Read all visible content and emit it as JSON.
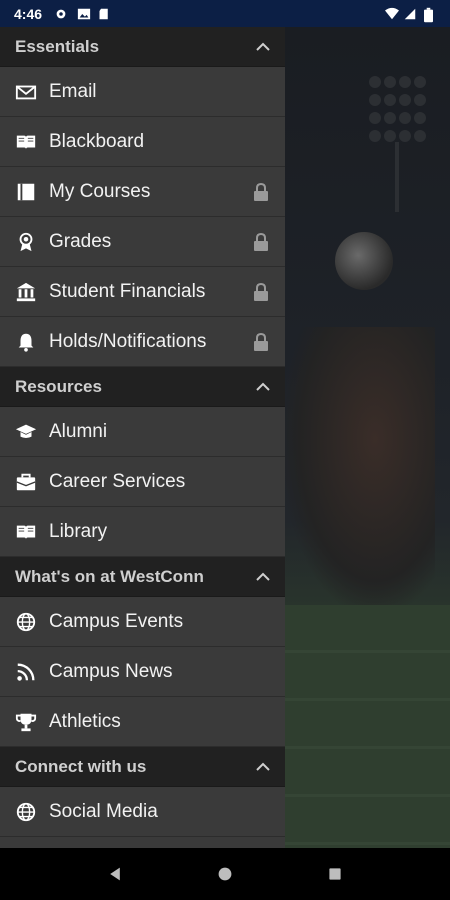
{
  "status_bar": {
    "time": "4:46",
    "icons": [
      "settings-icon",
      "image-icon",
      "sd-card-icon",
      "wifi-icon",
      "signal-icon",
      "battery-icon"
    ]
  },
  "drawer": {
    "sections": [
      {
        "title": "Essentials",
        "items": [
          {
            "label": "Email",
            "icon": "envelope-icon",
            "locked": false
          },
          {
            "label": "Blackboard",
            "icon": "book-open-icon",
            "locked": false
          },
          {
            "label": "My Courses",
            "icon": "book-icon",
            "locked": true
          },
          {
            "label": "Grades",
            "icon": "award-icon",
            "locked": true
          },
          {
            "label": "Student Financials",
            "icon": "bank-icon",
            "locked": true
          },
          {
            "label": "Holds/Notifications",
            "icon": "bell-icon",
            "locked": true
          }
        ]
      },
      {
        "title": "Resources",
        "items": [
          {
            "label": "Alumni",
            "icon": "graduation-cap-icon",
            "locked": false
          },
          {
            "label": "Career Services",
            "icon": "briefcase-icon",
            "locked": false
          },
          {
            "label": "Library",
            "icon": "book-open-icon",
            "locked": false
          }
        ]
      },
      {
        "title": "What's on at WestConn",
        "items": [
          {
            "label": "Campus Events",
            "icon": "globe-icon",
            "locked": false
          },
          {
            "label": "Campus News",
            "icon": "rss-icon",
            "locked": false
          },
          {
            "label": "Athletics",
            "icon": "trophy-icon",
            "locked": false
          }
        ]
      },
      {
        "title": "Connect with us",
        "items": [
          {
            "label": "Social Media",
            "icon": "globe-icon",
            "locked": false
          }
        ]
      }
    ]
  },
  "colors": {
    "status_bar": "#0c1f45",
    "drawer_bg": "#3a3a3a",
    "section_header_bg": "#212121",
    "text": "#f2f2f2",
    "lock": "#9a9a9a"
  }
}
